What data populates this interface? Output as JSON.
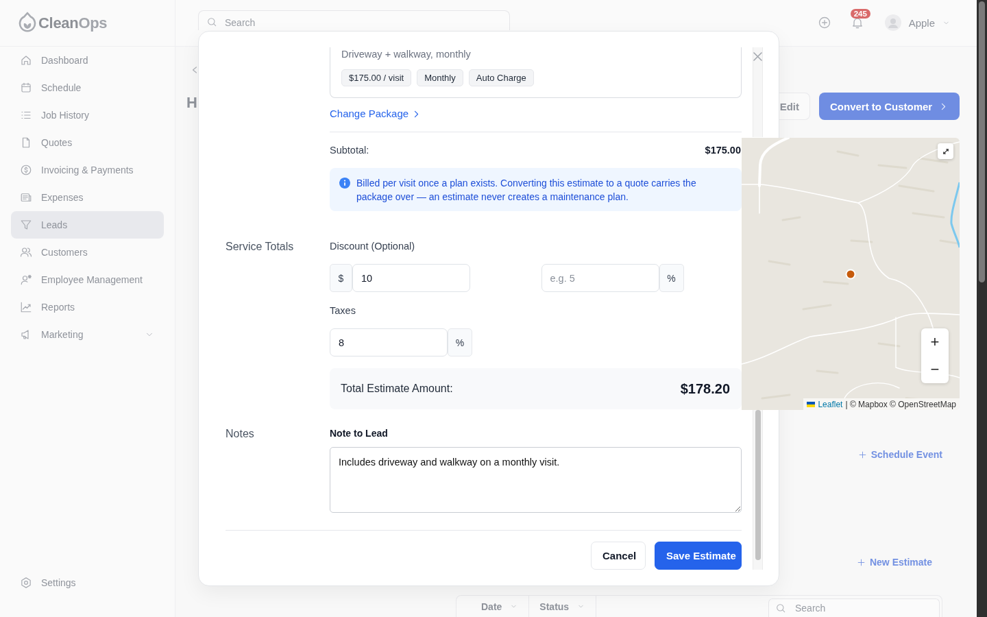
{
  "sidebar": {
    "logo": {
      "parts": [
        {
          "text": "Clean",
          "color": "#8d9096"
        },
        {
          "text": "Ops",
          "color": "#a2a5ab"
        }
      ]
    },
    "items": [
      {
        "label": "Dashboard",
        "kind": "link",
        "selected": false
      },
      {
        "label": "Schedule",
        "kind": "link",
        "selected": false
      },
      {
        "label": "Job History",
        "kind": "link",
        "selected": false
      },
      {
        "label": "Quotes",
        "kind": "link",
        "selected": false
      },
      {
        "label": "Invoicing & Payments",
        "kind": "link",
        "selected": false
      },
      {
        "label": "Expenses",
        "kind": "link",
        "selected": false
      },
      {
        "label": "Leads",
        "kind": "link",
        "selected": true
      },
      {
        "label": "Customers",
        "kind": "link",
        "selected": false
      },
      {
        "label": "Employee Management",
        "kind": "link",
        "selected": false
      },
      {
        "label": "Reports",
        "kind": "link",
        "selected": false
      },
      {
        "label": "Marketing",
        "kind": "group",
        "selected": false,
        "expanded": false
      }
    ],
    "footer": {
      "label": "Settings"
    }
  },
  "topbar": {
    "search": {
      "placeholder": "Search"
    },
    "notifications": {
      "count": "245"
    },
    "user": {
      "name": "Apple"
    }
  },
  "page": {
    "title": "H",
    "actions": [
      {
        "label": "Edit",
        "kind": "secondary"
      },
      {
        "label": "Convert to Customer",
        "kind": "primary"
      }
    ],
    "map": {
      "zoom_in": "+",
      "zoom_out": "−",
      "attribution": {
        "link": "Leaflet",
        "text": "| © Mapbox © OpenStreetMap"
      }
    },
    "schedule_button": "Schedule Event",
    "new_estimate_button": "New Estimate",
    "filters": [
      {
        "label": "Date"
      },
      {
        "label": "Status"
      }
    ],
    "table_search": {
      "placeholder": "Search"
    }
  },
  "modal": {
    "package": {
      "description": "Driveway + walkway, monthly",
      "tags": [
        "$175.00 / visit",
        "Monthly",
        "Auto Charge"
      ]
    },
    "change_package": "Change Package",
    "subtotal": {
      "label": "Subtotal:",
      "value": "$175.00"
    },
    "notice": "Billed per visit once a plan exists. Converting this estimate to a quote carries the package over — an estimate never creates a maintenance plan.",
    "service_totals": {
      "title": "Service Totals",
      "discount": {
        "label": "Discount (Optional)",
        "amount": {
          "prefix": "$",
          "value": "10"
        },
        "percent": {
          "placeholder": "e.g. 5",
          "suffix": "%"
        }
      },
      "taxes": {
        "label": "Taxes",
        "value": "8",
        "suffix": "%"
      },
      "total": {
        "label": "Total Estimate Amount:",
        "value": "$178.20"
      }
    },
    "notes": {
      "title": "Notes",
      "label": "Note to Lead",
      "value": "Includes driveway and walkway on a monthly visit."
    },
    "buttons": [
      {
        "label": "Cancel",
        "kind": "secondary"
      },
      {
        "label": "Save Estimate",
        "kind": "primary"
      }
    ]
  }
}
